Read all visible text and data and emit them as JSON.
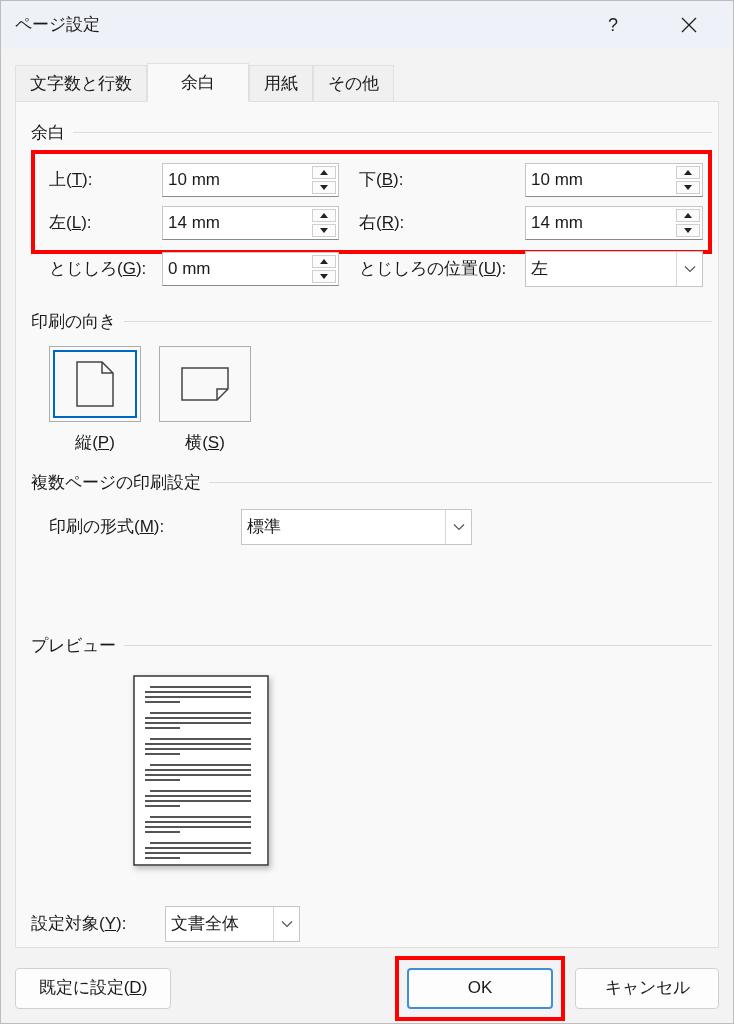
{
  "window": {
    "title": "ページ設定",
    "help_button": "?"
  },
  "tabs": [
    {
      "label": "文字数と行数",
      "selected": false
    },
    {
      "label": "余白",
      "selected": true
    },
    {
      "label": "用紙",
      "selected": false
    },
    {
      "label": "その他",
      "selected": false
    }
  ],
  "margins": {
    "heading": "余白",
    "highlighted": true,
    "rows": [
      [
        {
          "label_parts": [
            "上(",
            "T",
            "):"
          ],
          "value": "10 mm",
          "kind": "spin"
        },
        {
          "label_parts": [
            "下(",
            "B",
            "):"
          ],
          "value": "10 mm",
          "kind": "spin"
        }
      ],
      [
        {
          "label_parts": [
            "左(",
            "L",
            "):"
          ],
          "value": "14 mm",
          "kind": "spin"
        },
        {
          "label_parts": [
            "右(",
            "R",
            "):"
          ],
          "value": "14 mm",
          "kind": "spin"
        }
      ],
      [
        {
          "label_parts": [
            "とじしろ(",
            "G",
            "):"
          ],
          "value": "0 mm",
          "kind": "spin"
        },
        {
          "label_parts": [
            "とじしろの位置(",
            "U",
            "):"
          ],
          "value": "左",
          "kind": "select"
        }
      ]
    ]
  },
  "orientation": {
    "heading": "印刷の向き",
    "options": [
      {
        "label_parts": [
          "縦(",
          "P",
          ")"
        ],
        "selected": true,
        "kind": "portrait"
      },
      {
        "label_parts": [
          "横(",
          "S",
          ")"
        ],
        "selected": false,
        "kind": "landscape"
      }
    ]
  },
  "multiple_pages": {
    "heading": "複数ページの印刷設定",
    "label_parts": [
      "印刷の形式(",
      "M",
      "):"
    ],
    "value": "標準"
  },
  "preview": {
    "heading": "プレビュー"
  },
  "apply_to": {
    "label_parts": [
      "設定対象(",
      "Y",
      "):"
    ],
    "value": "文書全体"
  },
  "buttons": [
    {
      "label_parts": [
        "既定に設定(",
        "D",
        ")"
      ],
      "kind": "default",
      "highlighted": false,
      "focused": false
    },
    {
      "label_parts": [
        "OK"
      ],
      "kind": "ok",
      "highlighted": true,
      "focused": true
    },
    {
      "label_parts": [
        "キャンセル"
      ],
      "kind": "cancel",
      "highlighted": false,
      "focused": false
    }
  ]
}
